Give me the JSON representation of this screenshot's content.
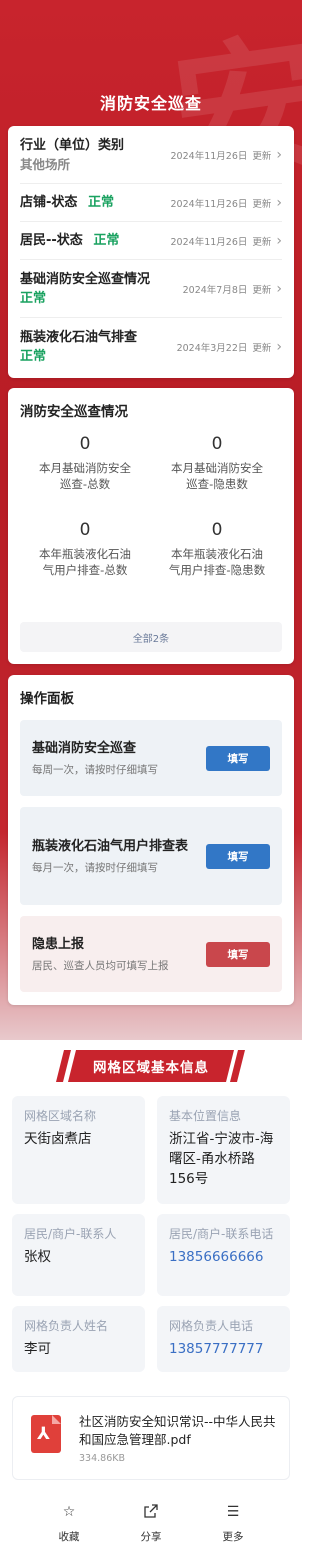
{
  "page_title": "消防安全巡查",
  "watermark": "安",
  "status_list": [
    {
      "label": "行业（单位）类别",
      "sub": "其他场所",
      "status": "",
      "date": "2024年11月26日",
      "update": "更新"
    },
    {
      "label": "店铺-状态",
      "sub": "",
      "status": "正常",
      "date": "2024年11月26日",
      "update": "更新"
    },
    {
      "label": "居民--状态",
      "sub": "",
      "status": "正常",
      "date": "2024年11月26日",
      "update": "更新"
    },
    {
      "label": "基础消防安全巡查情况",
      "sub": "",
      "status": "正常",
      "date": "2024年7月8日",
      "update": "更新"
    },
    {
      "label": "瓶装液化石油气排查",
      "sub": "",
      "status": "正常",
      "date": "2024年3月22日",
      "update": "更新"
    }
  ],
  "stats": {
    "title": "消防安全巡查情况",
    "items": [
      {
        "value": "0",
        "label": "本月基础消防安全巡查-总数"
      },
      {
        "value": "0",
        "label": "本月基础消防安全巡查-隐患数"
      },
      {
        "value": "0",
        "label": "本年瓶装液化石油气用户排查-总数"
      },
      {
        "value": "0",
        "label": "本年瓶装液化石油气用户排查-隐患数"
      }
    ],
    "all_link": "全部2条"
  },
  "ops": {
    "title": "操作面板",
    "items": [
      {
        "title": "基础消防安全巡查",
        "desc": "每周一次，请按时仔细填写",
        "button": "填写"
      },
      {
        "title": "瓶装液化石油气用户排查表",
        "desc": "每月一次，请按时仔细填写",
        "button": "填写"
      },
      {
        "title": "隐患上报",
        "desc": "居民、巡查人员均可填写上报",
        "button": "填写"
      }
    ]
  },
  "grid_info": {
    "title": "网格区域基本信息",
    "fields": [
      {
        "key": "网格区域名称",
        "value": "天街卤煮店"
      },
      {
        "key": "基本位置信息",
        "value": "浙江省-宁波市-海曙区-甬水桥路156号"
      },
      {
        "key": "居民/商户-联系人",
        "value": "张权"
      },
      {
        "key": "居民/商户-联系电话",
        "value": "13856666666"
      },
      {
        "key": "网格负责人姓名",
        "value": "李可"
      },
      {
        "key": "网格负责人电话",
        "value": "13857777777"
      }
    ]
  },
  "attachment": {
    "name": "社区消防安全知识常识--中华人民共和国应急管理部.pdf",
    "size": "334.86KB"
  },
  "bottom_bar": [
    {
      "icon": "star-icon",
      "label": "收藏"
    },
    {
      "icon": "share-icon",
      "label": "分享"
    },
    {
      "icon": "menu-icon",
      "label": "更多"
    }
  ],
  "colors": {
    "brand_red": "#c8242d",
    "ok_green": "#1aa260",
    "action_blue": "#3277c6",
    "warn_red": "#c9474c"
  }
}
